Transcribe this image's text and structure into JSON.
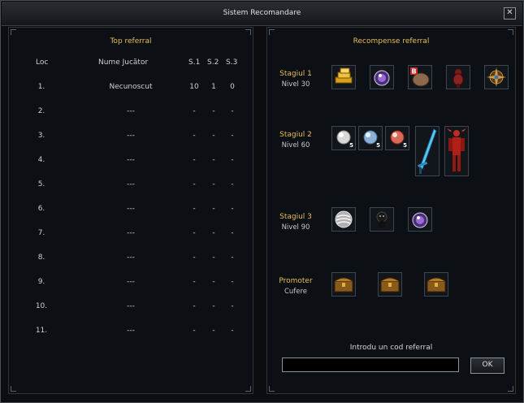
{
  "window": {
    "title": "Sistem Recomandare"
  },
  "left": {
    "title": "Top referral",
    "headers": {
      "loc": "Loc",
      "name": "Nume Jucător",
      "s1": "S.1",
      "s2": "S.2",
      "s3": "S.3"
    },
    "rows": [
      {
        "loc": "1.",
        "name": "Necunoscut",
        "s1": "10",
        "s2": "1",
        "s3": "0"
      },
      {
        "loc": "2.",
        "name": "---",
        "s1": "-",
        "s2": "-",
        "s3": "-"
      },
      {
        "loc": "3.",
        "name": "---",
        "s1": "-",
        "s2": "-",
        "s3": "-"
      },
      {
        "loc": "4.",
        "name": "---",
        "s1": "-",
        "s2": "-",
        "s3": "-"
      },
      {
        "loc": "5.",
        "name": "---",
        "s1": "-",
        "s2": "-",
        "s3": "-"
      },
      {
        "loc": "6.",
        "name": "---",
        "s1": "-",
        "s2": "-",
        "s3": "-"
      },
      {
        "loc": "7.",
        "name": "---",
        "s1": "-",
        "s2": "-",
        "s3": "-"
      },
      {
        "loc": "8.",
        "name": "---",
        "s1": "-",
        "s2": "-",
        "s3": "-"
      },
      {
        "loc": "9.",
        "name": "---",
        "s1": "-",
        "s2": "-",
        "s3": "-"
      },
      {
        "loc": "10.",
        "name": "---",
        "s1": "-",
        "s2": "-",
        "s3": "-"
      },
      {
        "loc": "11.",
        "name": "---",
        "s1": "-",
        "s2": "-",
        "s3": "-"
      }
    ]
  },
  "right": {
    "title": "Recompense referral",
    "stages": [
      {
        "name": "Stagiul 1",
        "level": "Nivel 30"
      },
      {
        "name": "Stagiul 2",
        "level": "Nivel 60"
      },
      {
        "name": "Stagiul 3",
        "level": "Nivel 90"
      },
      {
        "name": "Promoter",
        "level": "Cufere"
      }
    ],
    "stage2_qty": [
      "5",
      "5",
      "5"
    ],
    "code_label": "Introdu un cod referral",
    "code_value": "",
    "ok_label": "OK",
    "icons": {
      "s1": [
        "gold-bars-icon",
        "potion-icon",
        "bag-b-icon",
        "red-armor-icon",
        "compass-star-icon"
      ],
      "s2": [
        "white-pearl-icon",
        "blue-pearl-icon",
        "red-pearl-icon",
        "blue-sword-icon",
        "red-costume-icon"
      ],
      "s3": [
        "silver-orb-icon",
        "black-pet-icon",
        "potion-icon"
      ],
      "promoter": [
        "chest-icon",
        "chest-icon",
        "chest-icon"
      ]
    }
  }
}
